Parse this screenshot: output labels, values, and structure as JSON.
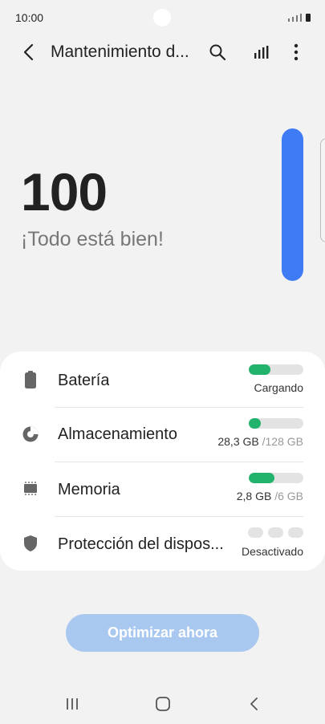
{
  "status_bar": {
    "time": "10:00"
  },
  "app_bar": {
    "title": "Mantenimiento d..."
  },
  "score": {
    "value": "100",
    "status": "¡Todo está bien!",
    "level_percent": 100
  },
  "items": [
    {
      "label": "Batería",
      "value": "Cargando",
      "value_sub": "",
      "fill_percent": 40,
      "icon": "battery-icon"
    },
    {
      "label": "Almacenamiento",
      "value": "28,3 GB",
      "value_sub": " /128 GB",
      "fill_percent": 22,
      "icon": "storage-pie-icon"
    },
    {
      "label": "Memoria",
      "value": "2,8 GB",
      "value_sub": " /6 GB",
      "fill_percent": 47,
      "icon": "memory-chip-icon"
    },
    {
      "label": "Protección del dispos...",
      "value": "Desactivado",
      "value_sub": "",
      "fill_percent": 0,
      "icon": "shield-icon"
    }
  ],
  "actions": {
    "optimize_label": "Optimizar ahora"
  },
  "colors": {
    "accent_blue": "#3e7bf5",
    "status_green": "#21b26c",
    "button_disabled": "#a9c8ef"
  }
}
